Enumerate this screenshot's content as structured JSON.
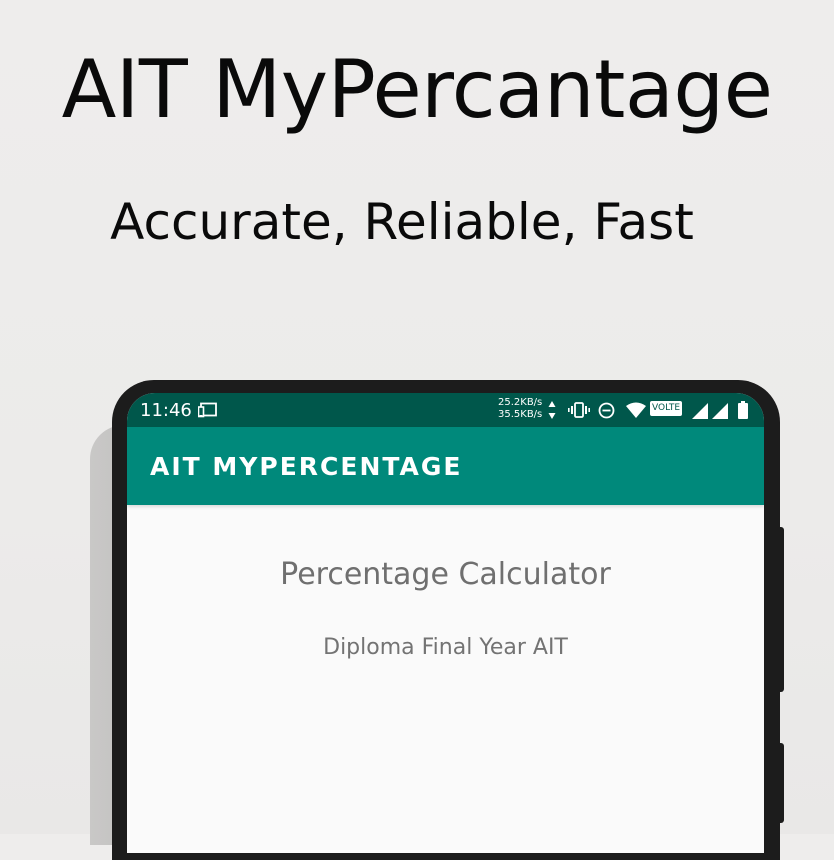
{
  "promo": {
    "headline": "AIT MyPercantage",
    "tagline": "Accurate, Reliable, Fast"
  },
  "status_bar": {
    "time": "11:46",
    "upload_speed": "25.2KB/s",
    "download_speed": "35.5KB/s",
    "volte_label": "VOLTE",
    "icons": [
      "cast-icon",
      "data-arrows-icon",
      "vibrate-icon",
      "do-not-disturb-icon",
      "wifi-icon",
      "signal-icon",
      "signal-icon",
      "battery-icon"
    ]
  },
  "app_bar": {
    "title": "AIT MYPERCENTAGE"
  },
  "content": {
    "title": "Percentage Calculator",
    "subtitle": "Diploma Final Year AIT"
  },
  "colors": {
    "status_bar": "#00574b",
    "app_bar": "#00897b",
    "screen_background": "#fafafa",
    "phone_frame": "#1c1c1c",
    "page_background": "#eeedec"
  }
}
